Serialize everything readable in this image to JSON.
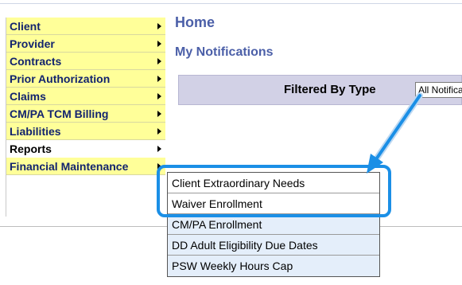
{
  "menu": {
    "items": [
      {
        "label": "Client",
        "arrow": true
      },
      {
        "label": "Provider",
        "arrow": true
      },
      {
        "label": "Contracts",
        "arrow": true
      },
      {
        "label": "Prior Authorization",
        "arrow": true
      },
      {
        "label": "Claims",
        "arrow": true
      },
      {
        "label": "CM/PA TCM Billing",
        "arrow": true
      },
      {
        "label": "Liabilities",
        "arrow": true
      },
      {
        "label": "Reports",
        "arrow": true
      },
      {
        "label": "Financial Maintenance",
        "arrow": true
      }
    ],
    "active_index": 7
  },
  "page": {
    "title": "Home",
    "notifications_title": "My Notifications"
  },
  "filter": {
    "label": "Filtered By Type",
    "select_value": "All Notifications"
  },
  "reports_submenu": {
    "items": [
      {
        "label": "Client Extraordinary Needs",
        "highlighted": true
      },
      {
        "label": "Waiver Enrollment",
        "highlighted": true
      },
      {
        "label": "CM/PA Enrollment",
        "highlighted": false
      },
      {
        "label": "DD Adult Eligibility Due Dates",
        "highlighted": false
      },
      {
        "label": "PSW Weekly Hours Cap",
        "highlighted": false
      }
    ]
  },
  "colors": {
    "menu_bg": "#ffff99",
    "menu_text": "#12236e",
    "title_text": "#4b5fa8",
    "filter_bar_bg": "#d2d1e6",
    "submenu_plain_bg": "#e4eefa",
    "highlight": "#1b8fe6"
  }
}
